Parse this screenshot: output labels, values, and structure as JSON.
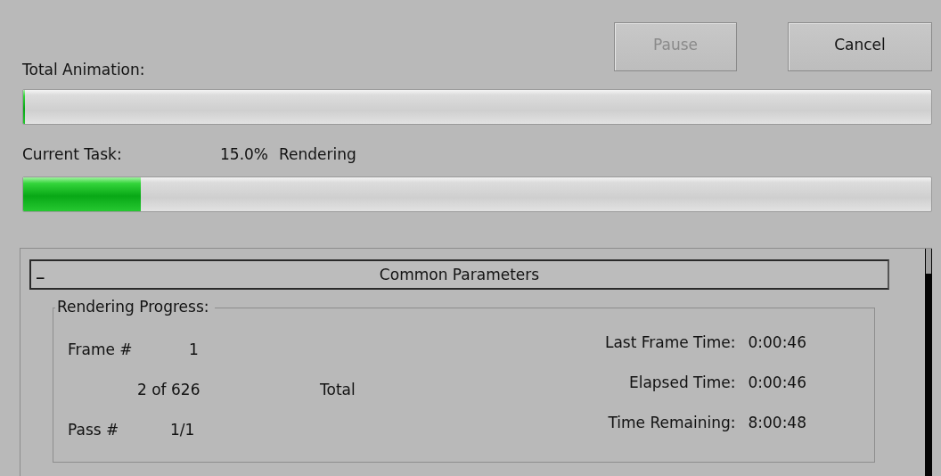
{
  "buttons": [
    {
      "label": "Pause",
      "disabled": true
    },
    {
      "label": "Cancel",
      "disabled": false
    }
  ],
  "total_animation": {
    "label": "Total Animation:",
    "level": 0
  },
  "current_task": {
    "label": "Current Task:",
    "percent": "15.0%",
    "status": "Rendering",
    "level": 0.13
  },
  "rollout": {
    "symbol": "_",
    "title": "Common Parameters",
    "expanded": true,
    "group": {
      "title": "Rendering Progress:",
      "frame_label": "Frame #",
      "frame_value": "1",
      "frames": "2 of 626",
      "frames_caption": "Total",
      "pass_label": "Pass #",
      "pass_value": "1/1",
      "stats": [
        {
          "label": "Last Frame Time:",
          "value": "0:00:46"
        },
        {
          "label": "Elapsed Time:",
          "value": "0:00:46"
        },
        {
          "label": "Time Remaining:",
          "value": "8:00:48"
        }
      ]
    }
  }
}
